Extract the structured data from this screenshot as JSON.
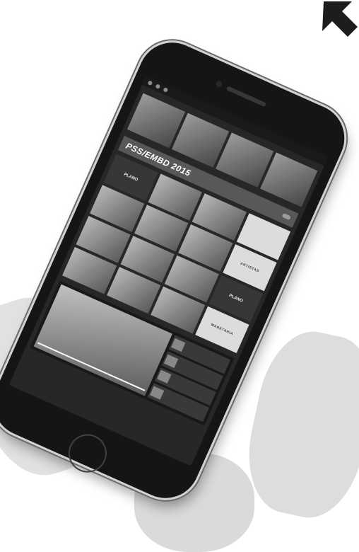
{
  "screen": {
    "hero_title": "",
    "hero_thumbs": [
      {
        "caption": ""
      },
      {
        "caption": ""
      },
      {
        "caption": ""
      },
      {
        "caption": ""
      }
    ],
    "banner": {
      "title": "PSS/EMBD 2015",
      "button_label": ""
    },
    "grid_tiles": [
      {
        "kind": "logo",
        "text": "PLANO"
      },
      {
        "kind": "photo",
        "text": ""
      },
      {
        "kind": "photo",
        "text": ""
      },
      {
        "kind": "light",
        "text": ""
      },
      {
        "kind": "photo",
        "text": ""
      },
      {
        "kind": "photo",
        "text": ""
      },
      {
        "kind": "photo",
        "text": ""
      },
      {
        "kind": "light",
        "text": "ARTISTAS"
      },
      {
        "kind": "photo",
        "text": ""
      },
      {
        "kind": "photo",
        "text": ""
      },
      {
        "kind": "photo",
        "text": ""
      },
      {
        "kind": "logo",
        "text": "PLANO"
      },
      {
        "kind": "photo",
        "text": ""
      },
      {
        "kind": "photo",
        "text": ""
      },
      {
        "kind": "photo",
        "text": ""
      },
      {
        "kind": "light",
        "text": "MARETARIA"
      }
    ],
    "video": {
      "caption": "",
      "playlist": [
        {
          "title": ""
        },
        {
          "title": ""
        },
        {
          "title": ""
        },
        {
          "title": ""
        }
      ]
    }
  },
  "colors": {
    "bezel": "#1a1a1a",
    "screen_bg": "#2b2b2b",
    "banner_bg": "#5a5a5a"
  }
}
